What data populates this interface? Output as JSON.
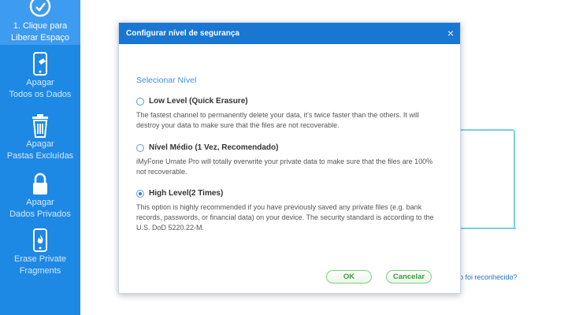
{
  "sidebar": {
    "items": [
      {
        "label_line1": "1. Clique para",
        "label_line2": "Liberar Espaço",
        "icon": "broom-check-icon"
      },
      {
        "label_line1": "Apagar",
        "label_line2": "Todos os Dados",
        "icon": "phone-erase-icon"
      },
      {
        "label_line1": "Apagar",
        "label_line2": "Pastas Excluídas",
        "icon": "trash-icon"
      },
      {
        "label_line1": "Apagar",
        "label_line2": "Dados Privados",
        "icon": "lock-icon"
      },
      {
        "label_line1": "Erase Private",
        "label_line2": "Fragments",
        "icon": "phone-fire-icon"
      }
    ]
  },
  "background": {
    "link_text": "o foi reconhecido?"
  },
  "dialog": {
    "title": "Configurar nível de segurança",
    "close_glyph": "×",
    "section_heading": "Selecionar Nível",
    "options": [
      {
        "name": "Low Level (Quick Erasure)",
        "description": "The fastest channel to permanently delete your data, it's twice faster than the others. It will destroy your data to make sure that the files are not recoverable.",
        "selected": false
      },
      {
        "name": "Nível Médio (1 Vez, Recomendado)",
        "description": "iMyFone Umate Pro will totally overwrite your private data to make sure that the files are 100% not recoverable.",
        "selected": false
      },
      {
        "name": "High Level(2 Times)",
        "description": "This option is highly recommended if you have previously saved any private files (e.g. bank records, passwords, or financial data) on your device. The security standard is according to the U.S. DoD 5220.22-M.",
        "selected": true
      }
    ],
    "ok_label": "OK",
    "cancel_label": "Cancelar"
  },
  "colors": {
    "sidebar": "#1e88e5",
    "title_bar": "#1976d2",
    "button_green": "#3a9a3a",
    "link_blue": "#3f8fd6"
  }
}
